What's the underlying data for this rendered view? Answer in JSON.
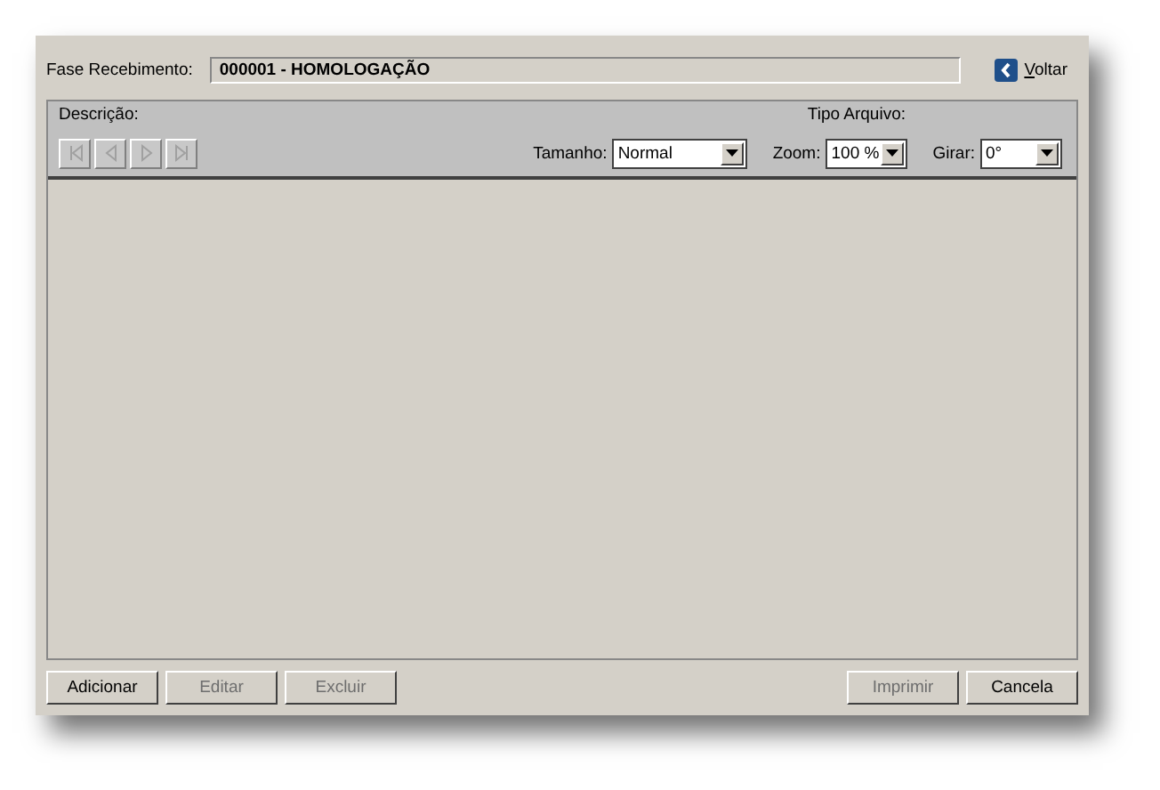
{
  "header": {
    "label": "Fase Recebimento:",
    "value": "000001 - HOMOLOGAÇÃO",
    "back_link": "Voltar"
  },
  "toolbar": {
    "description_label": "Descrição:",
    "file_type_label": "Tipo Arquivo:",
    "nav_buttons": [
      {
        "kind": "first",
        "disabled": true
      },
      {
        "kind": "previous",
        "disabled": true
      },
      {
        "kind": "next",
        "disabled": true
      },
      {
        "kind": "last",
        "disabled": true
      }
    ],
    "selects": [
      {
        "label": "Tamanho:",
        "value": "Normal"
      },
      {
        "label": "Zoom:",
        "value": "100 %"
      },
      {
        "label": "Girar:",
        "value": "0°"
      }
    ]
  },
  "buttons_left": [
    {
      "label": "Adicionar",
      "disabled": false
    },
    {
      "label": "Editar",
      "disabled": true
    },
    {
      "label": "Excluir",
      "disabled": true
    }
  ],
  "buttons_right": [
    {
      "label": "Imprimir",
      "disabled": true
    },
    {
      "label": "Cancela",
      "disabled": false
    }
  ]
}
